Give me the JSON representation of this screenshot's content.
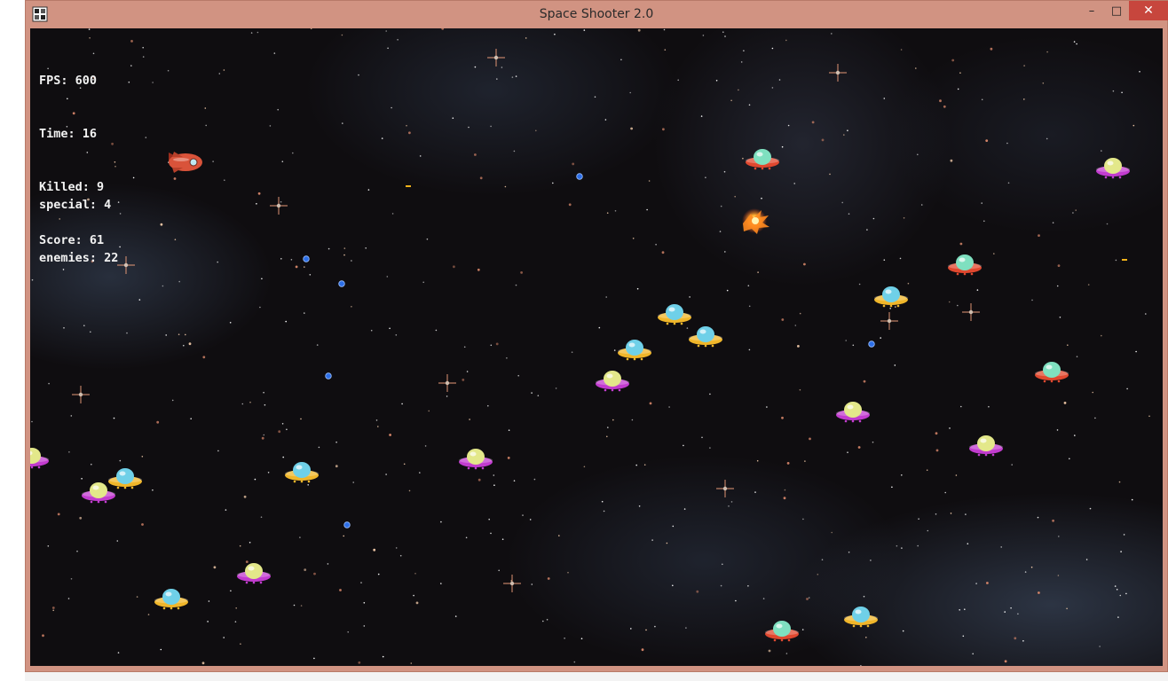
{
  "window": {
    "title": "Space Shooter 2.0",
    "min_glyph": "–",
    "max_glyph": "□",
    "close_glyph": "✕",
    "frame_color": "#d19382",
    "close_color": "#c7463d"
  },
  "hud": {
    "stats": [
      {
        "label": "FPS",
        "value": "600"
      },
      {
        "label": "Time",
        "value": "16"
      },
      {
        "label": "Killed",
        "value": "9"
      },
      {
        "label": "Score",
        "value": "61"
      }
    ],
    "counts": [
      {
        "label": "special",
        "value": "4"
      },
      {
        "label": "enemies",
        "value": "22"
      }
    ]
  },
  "game": {
    "background": "space-nebula-starfield",
    "player": {
      "icon": "rocket-ship-icon",
      "color": "#d9533a"
    },
    "enemy_variants": {
      "purple": {
        "saucer": "#c23ccf",
        "dome": "#e3e88a"
      },
      "orange": {
        "saucer": "#f0b62a",
        "dome": "#6fd0e8"
      },
      "red": {
        "saucer": "#e0482f",
        "dome": "#7fe0c0"
      }
    },
    "bullet_color": "#2d6fe8",
    "laser_color": "#f1b21a",
    "explosion": "explosion-icon"
  }
}
